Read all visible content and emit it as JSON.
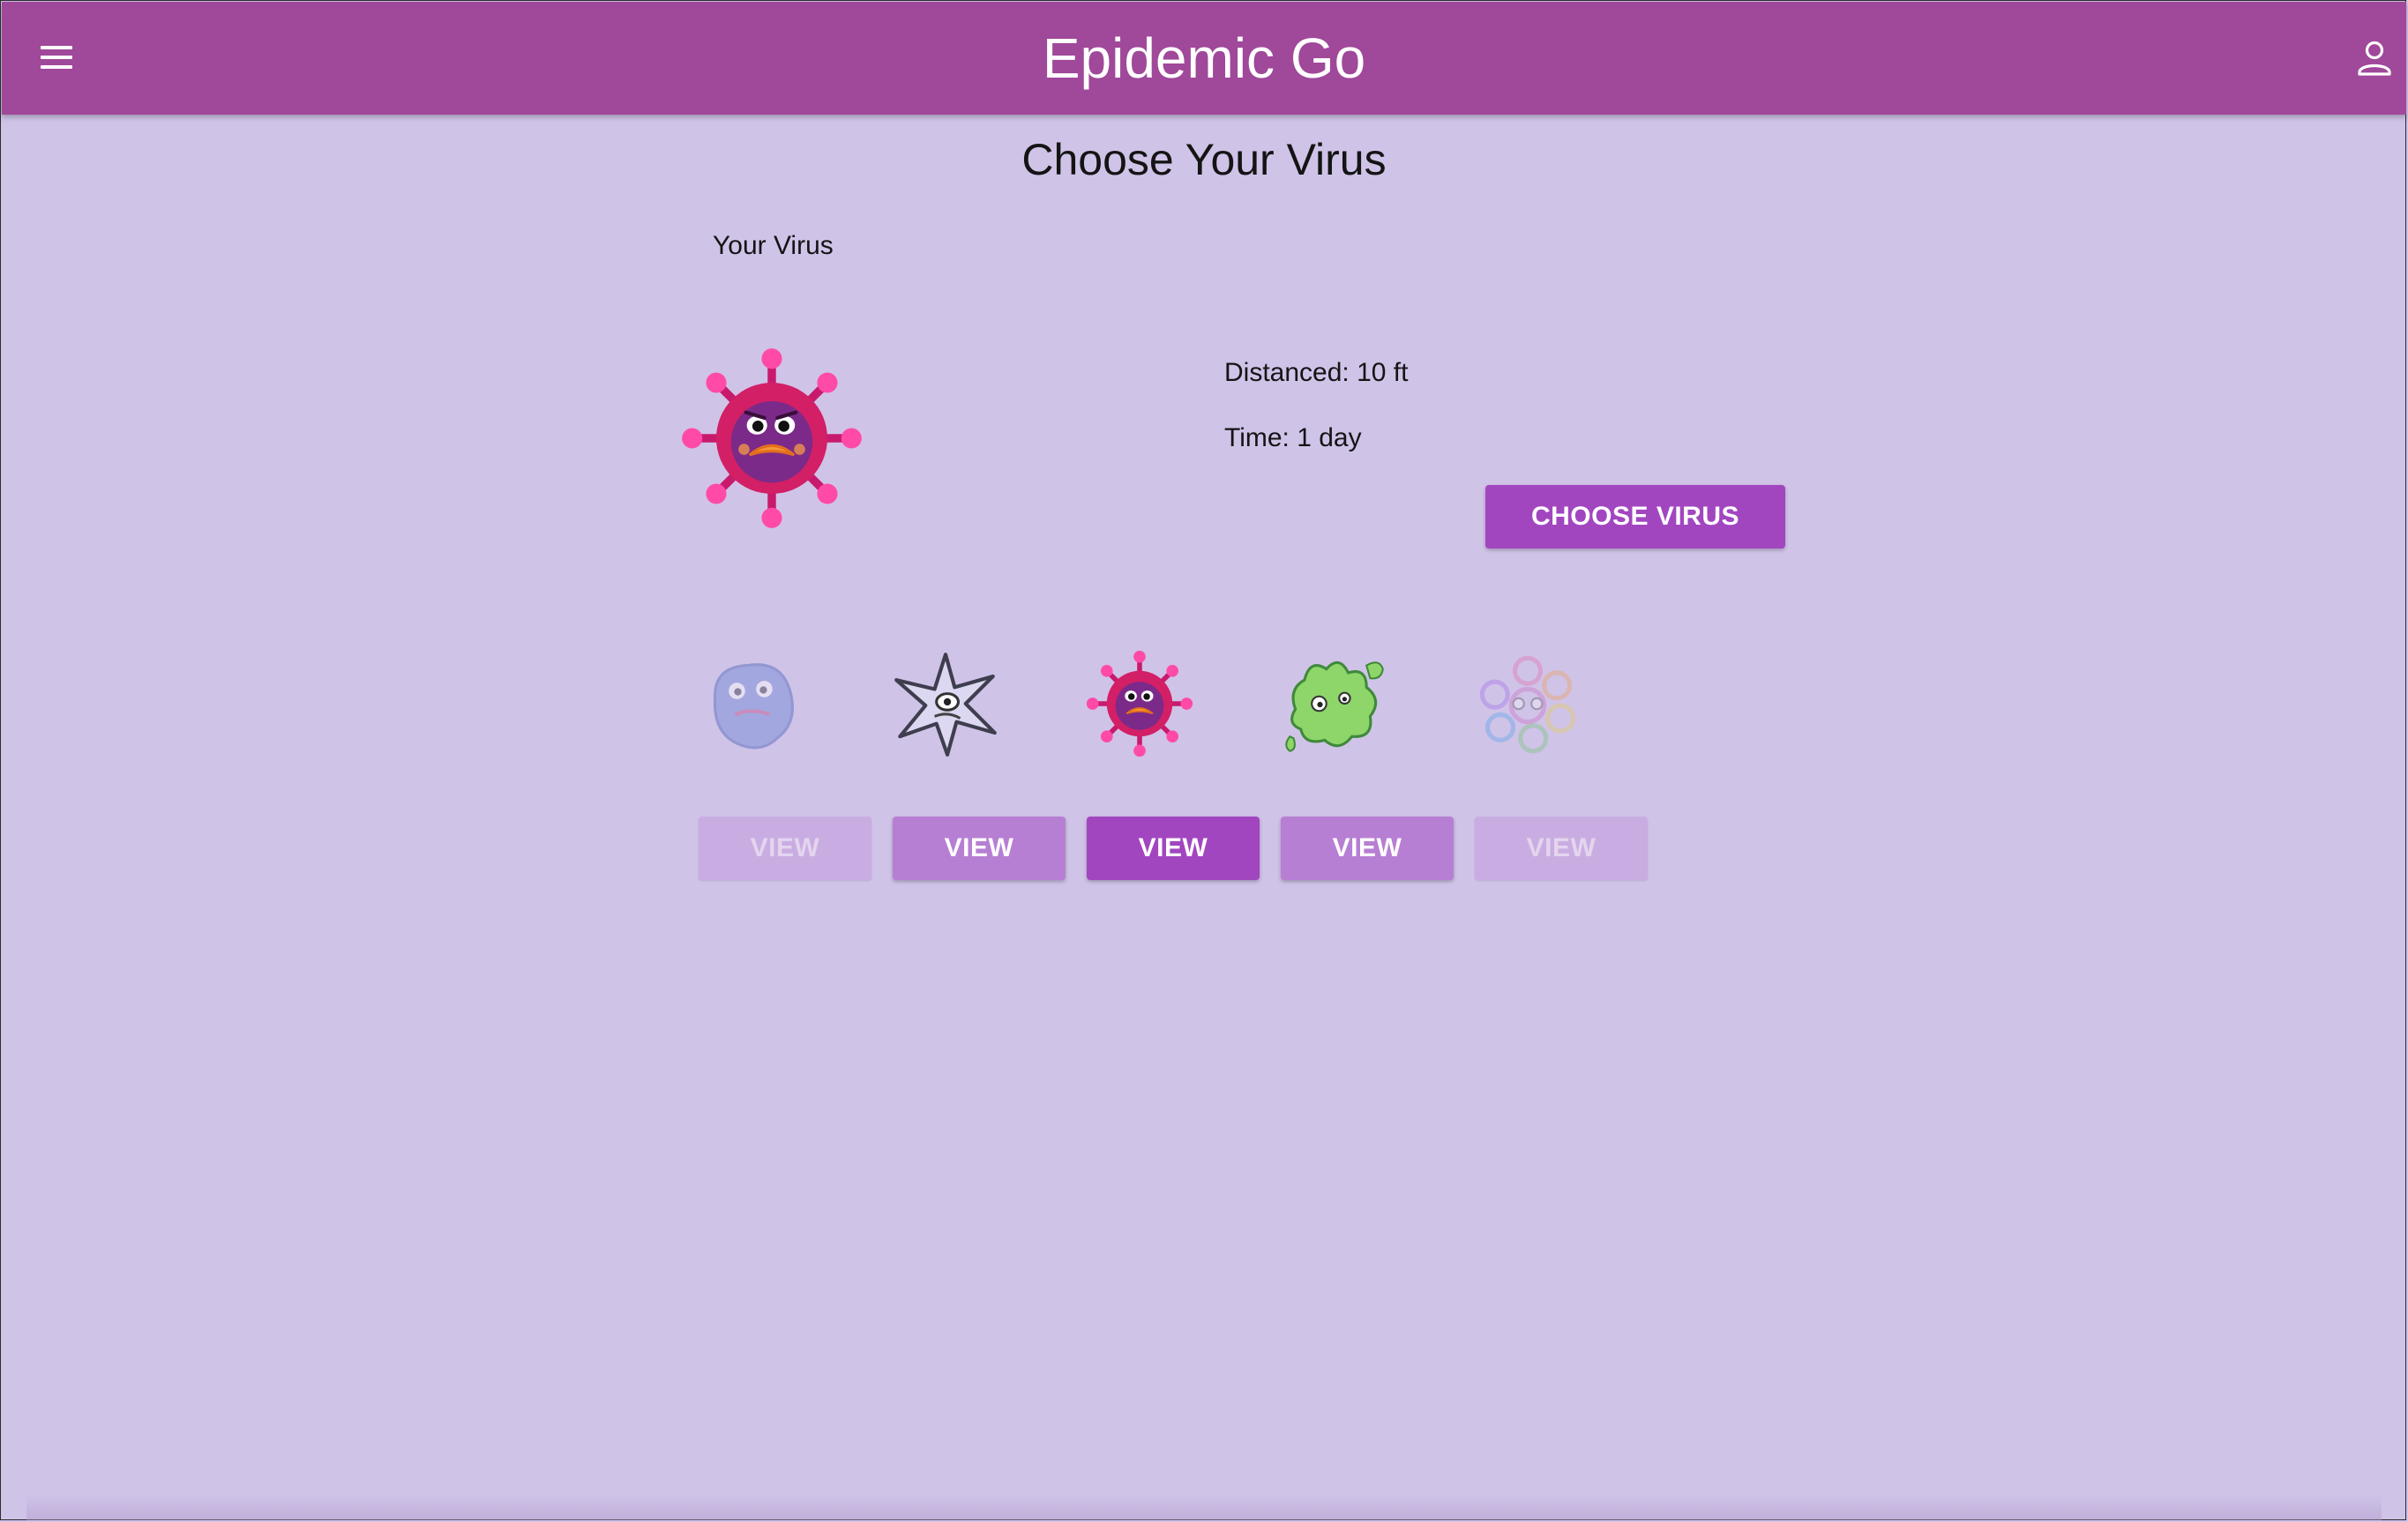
{
  "app": {
    "title": "Epidemic Go"
  },
  "header": {
    "menu_icon": "hamburger-menu-icon",
    "account_icon": "person-outline-icon"
  },
  "page": {
    "title": "Choose Your Virus"
  },
  "selection": {
    "label": "Your Virus",
    "distanced": "Distanced: 10 ft",
    "time": "Time: 1 day",
    "choose_label": "CHOOSE VIRUS"
  },
  "viruses": [
    {
      "view_label": "VIEW",
      "state": "disabled",
      "icon": "blue-blob-virus-icon"
    },
    {
      "view_label": "VIEW",
      "state": "enabled",
      "icon": "spiky-star-virus-icon"
    },
    {
      "view_label": "VIEW",
      "state": "selected",
      "icon": "angry-red-virus-icon"
    },
    {
      "view_label": "VIEW",
      "state": "enabled",
      "icon": "green-slime-virus-icon"
    },
    {
      "view_label": "VIEW",
      "state": "disabled",
      "icon": "rainbow-ring-virus-icon"
    }
  ],
  "colors": {
    "header": "#a0489a",
    "background": "#d0c3e8",
    "button_primary": "#a246c0",
    "button_secondary": "#b77fd3",
    "button_disabled": "#c9ade2"
  }
}
